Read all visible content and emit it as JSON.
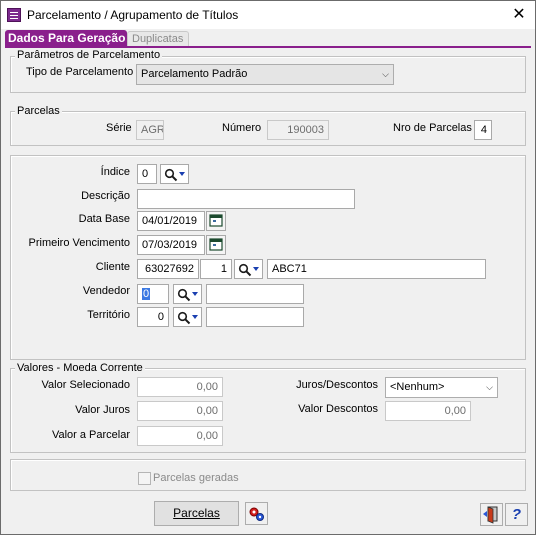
{
  "window": {
    "title": "Parcelamento / Agrupamento de Títulos",
    "close": "✕"
  },
  "tabs": [
    {
      "label": "Dados Para Geração",
      "active": true
    },
    {
      "label": "Duplicatas",
      "active": false
    }
  ],
  "parametros": {
    "legend": "Parâmetros de Parcelamento",
    "tipo_label": "Tipo de Parcelamento",
    "tipo_value": "Parcelamento Padrão"
  },
  "parcelas": {
    "legend": "Parcelas",
    "serie_label": "Série",
    "serie_value": "AGR",
    "numero_label": "Número",
    "numero_value": "190003",
    "nro_label": "Nro de Parcelas",
    "nro_value": "4"
  },
  "dados": {
    "indice_label": "Índice",
    "indice_value": "0",
    "descricao_label": "Descrição",
    "descricao_value": "",
    "data_base_label": "Data Base",
    "data_base_value": "04/01/2019",
    "primeiro_venc_label": "Primeiro Vencimento",
    "primeiro_venc_value": "07/03/2019",
    "cliente_label": "Cliente",
    "cliente_code": "63027692",
    "cliente_loja": "1",
    "cliente_name": "ABC71",
    "vendedor_label": "Vendedor",
    "vendedor_value": "0",
    "vendedor_name": "",
    "territorio_label": "Território",
    "territorio_value": "0",
    "territorio_name": ""
  },
  "valores": {
    "legend": "Valores - Moeda Corrente",
    "selecionado_label": "Valor Selecionado",
    "selecionado_value": "0,00",
    "juros_label": "Valor Juros",
    "juros_value": "0,00",
    "parcelar_label": "Valor a Parcelar",
    "parcelar_value": "0,00",
    "juros_desc_label": "Juros/Descontos",
    "juros_desc_value": "<Nenhum>",
    "descontos_label": "Valor Descontos",
    "descontos_value": "0,00"
  },
  "geradas": {
    "label": "Parcelas geradas",
    "checked": false
  },
  "footer": {
    "parcelas_button": "Parcelas",
    "help_glyph": "?"
  },
  "colors": {
    "accent": "#8a1f8c",
    "selection": "#3b79e3",
    "lookup_icon": "#1a3fb0"
  },
  "icons": {
    "app": "app-icon",
    "lookup": "magnifier-icon",
    "calendar": "calendar-icon",
    "gear": "gear-icon",
    "exit": "exit-door-icon",
    "help": "help-icon"
  }
}
